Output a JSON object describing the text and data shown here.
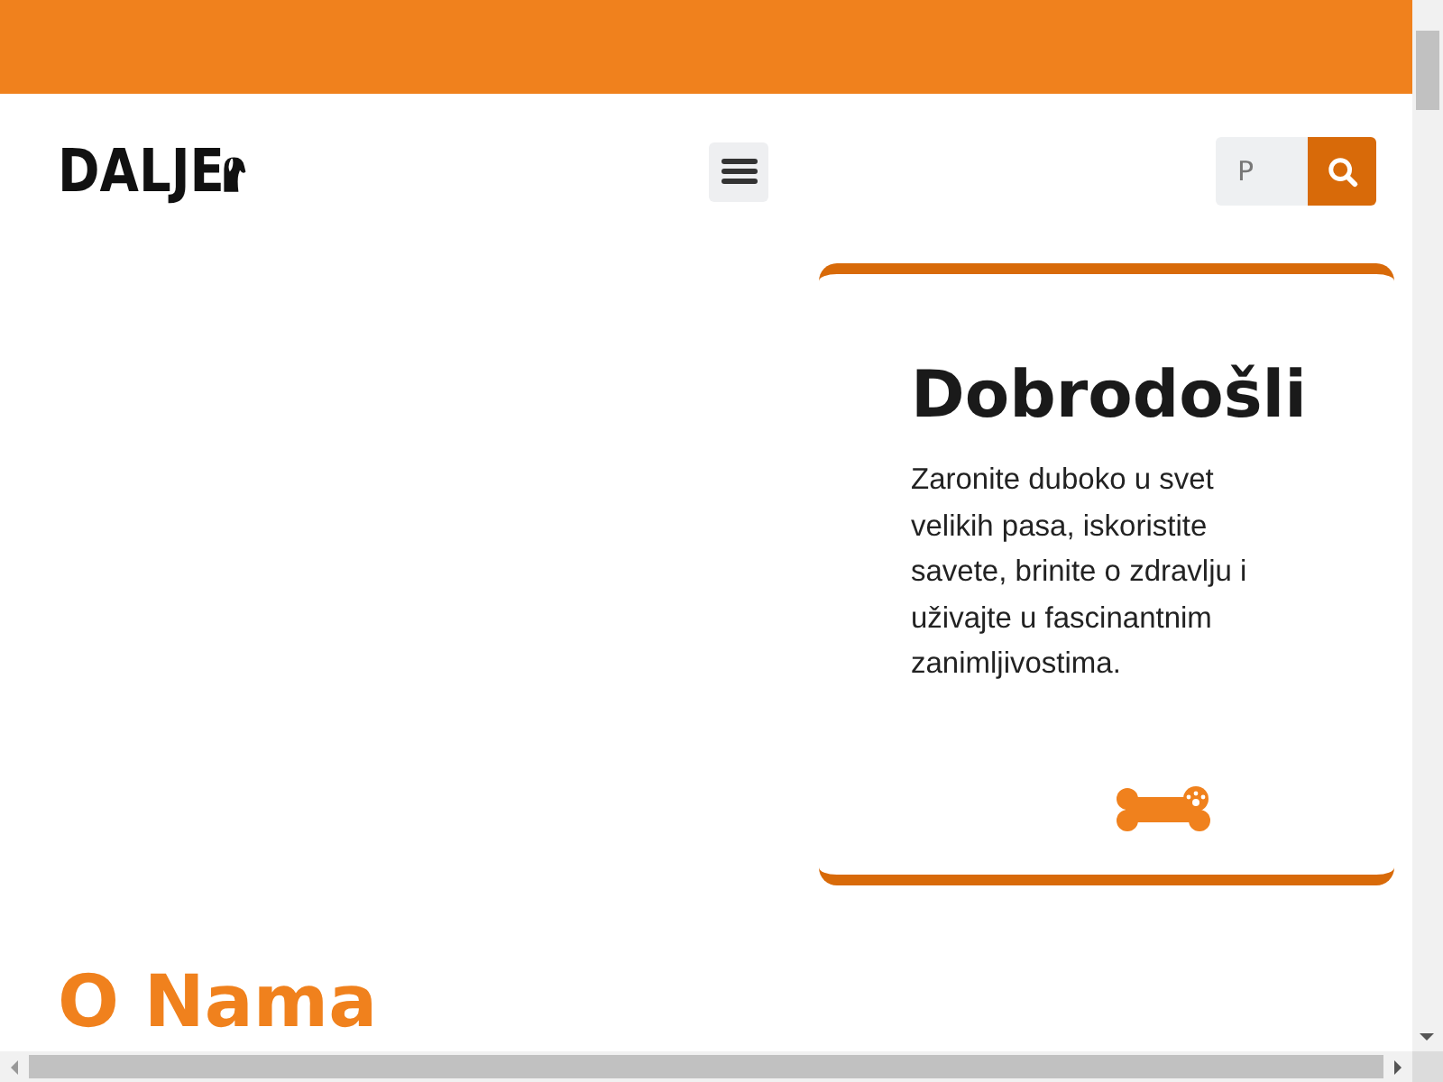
{
  "header": {
    "logo": "DALJE",
    "search": {
      "placeholder": "P"
    }
  },
  "hero_card": {
    "title": "Dobrodošli",
    "text": "Zaronite duboko u svet velikih pasa, iskoristite savete, brinite o zdravlju i uživajte u fascinantnim zanimljivostima."
  },
  "section": {
    "title": "O Nama"
  }
}
